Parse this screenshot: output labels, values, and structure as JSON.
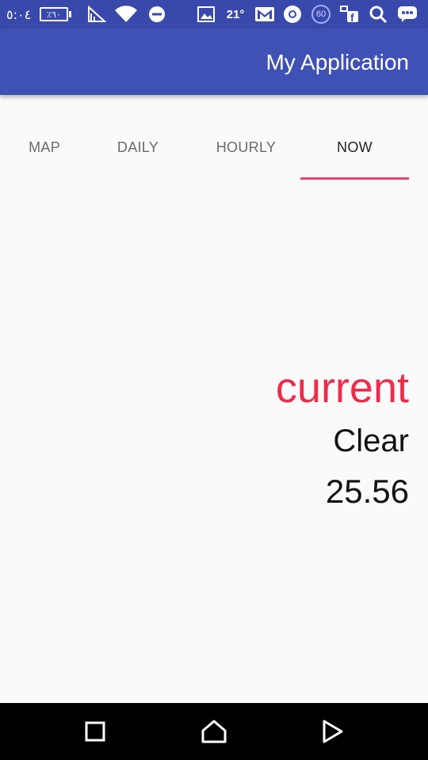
{
  "status_bar": {
    "time": "٥:٠٤",
    "battery_text": "٪٦٠",
    "temperature": "21°",
    "badge_count": "60",
    "icons": [
      "signal-icon",
      "wifi-icon",
      "do-not-disturb-icon",
      "gallery-icon",
      "gmail-icon",
      "chrome-icon",
      "badge-60-icon",
      "facebook-icon",
      "search-icon",
      "messenger-icon"
    ]
  },
  "app_bar": {
    "title": "My Application"
  },
  "tabs": [
    {
      "label": "MAP",
      "active": false
    },
    {
      "label": "DAILY",
      "active": false
    },
    {
      "label": "HOURLY",
      "active": false
    },
    {
      "label": "NOW",
      "active": true
    }
  ],
  "weather": {
    "label": "current",
    "condition": "Clear",
    "temperature": "25.56"
  },
  "colors": {
    "status_bar": "#3949ab",
    "app_bar": "#3f51b5",
    "accent": "#e94075",
    "label_red": "#ee2c4a"
  },
  "nav_bar": {
    "buttons": [
      "recents-button",
      "home-button",
      "back-button"
    ]
  }
}
